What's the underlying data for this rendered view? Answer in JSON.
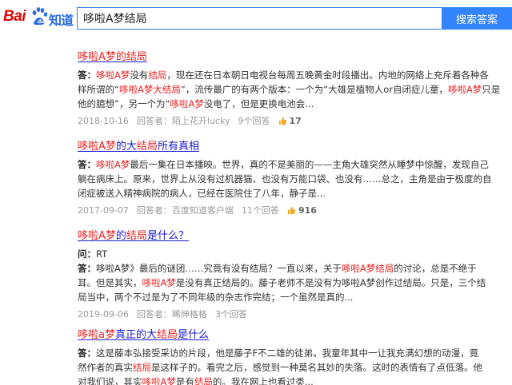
{
  "logo": {
    "bai": "Bai",
    "zhidao": "知道"
  },
  "search": {
    "query": "哆啦A梦结局",
    "button": "搜索答案"
  },
  "results": [
    {
      "title": [
        {
          "t": "哆啦A梦的",
          "h": true
        },
        {
          "t": "结局",
          "h": true
        }
      ],
      "lines": [
        [
          {
            "t": "答：",
            "lab": true
          },
          {
            "t": "哆啦A梦",
            "h": true
          },
          {
            "t": "没有"
          },
          {
            "t": "结局",
            "h": true
          },
          {
            "t": "，现在还在日本朝日电视台每周五晚黄金时段播出。内地的网络上充斥着各种各"
          }
        ],
        [
          {
            "t": "样所谓的“"
          },
          {
            "t": "哆啦A梦大结局",
            "h": true
          },
          {
            "t": "”，流传最广的有两个版本：一个为“大雄是植物人or自闭症儿童，"
          },
          {
            "t": "哆啦A梦",
            "h": true
          },
          {
            "t": "只是"
          }
        ],
        [
          {
            "t": "他的臆想”，另一个为“"
          },
          {
            "t": "哆啦A梦",
            "h": true
          },
          {
            "t": "没电了，但是更换电池会..."
          }
        ]
      ],
      "date": "2018-10-16",
      "answerer": "回答者：陌上花开lucky",
      "count": "9个回答",
      "likes": "17"
    },
    {
      "title": [
        {
          "t": "哆啦A梦",
          "h": true
        },
        {
          "t": "的大"
        },
        {
          "t": "结局",
          "h": true
        },
        {
          "t": "所有真相"
        }
      ],
      "lines": [
        [
          {
            "t": "答：",
            "lab": true
          },
          {
            "t": "哆啦A梦",
            "h": true
          },
          {
            "t": "最后一集在日本播映。世界，真的不是美丽的——主角大雄突然从睡梦中惊醒，发现自己"
          }
        ],
        [
          {
            "t": "躺在病床上。原来，世界上从没有过机器猫、也没有万能口袋、也没有……总之，主角是由于极度的自"
          }
        ],
        [
          {
            "t": "闭症被送入精神病院的病人，已经在医院住了八年，静子是..."
          }
        ]
      ],
      "date": "2017-09-07",
      "answerer": "回答者：百度知道客户端",
      "count": "11个回答",
      "likes": "916"
    },
    {
      "title": [
        {
          "t": "哆啦A梦",
          "h": true
        },
        {
          "t": "的"
        },
        {
          "t": "结局",
          "h": true
        },
        {
          "t": "是什么？"
        }
      ],
      "lines": [
        [
          {
            "t": "问：",
            "lab": true
          },
          {
            "t": "RT"
          }
        ],
        [
          {
            "t": "答：",
            "lab": true
          },
          {
            "t": "哆啦A梦》最后的谜团……究竟有没有结局？一直以来，关于"
          },
          {
            "t": "哆啦A梦结局",
            "h": true
          },
          {
            "t": "的讨论，总是不绝于"
          }
        ],
        [
          {
            "t": "耳。但是其实，"
          },
          {
            "t": "哆啦A梦",
            "h": true
          },
          {
            "t": "是没有真正结局的。藤子老师不是没有为哆啦A梦创作过结局。只是，三个结"
          }
        ],
        [
          {
            "t": "局当中，两个不过是为了不同年级的杂志作完结；一个虽然是真的..."
          }
        ]
      ],
      "date": "2019-09-06",
      "answerer": "回答者：晞绅格格",
      "count": "3个回答"
    },
    {
      "title": [
        {
          "t": "哆啦a梦",
          "h": true
        },
        {
          "t": "真正的大"
        },
        {
          "t": "结局",
          "h": true
        },
        {
          "t": "是什么"
        }
      ],
      "lines": [
        [
          {
            "t": "答：",
            "lab": true
          },
          {
            "t": "这是藤本弘接受采访的片段，他是藤子F不二雄的徒弟。我童年其中一让我充满幻想的动漫，竟"
          }
        ],
        [
          {
            "t": "然作者的真实"
          },
          {
            "t": "结局",
            "h": true
          },
          {
            "t": "是这样子的。看完之后，感觉到一种莫名其妙的失落。这时的表情有了点低落。他"
          }
        ],
        [
          {
            "t": "对我们说，其实"
          },
          {
            "t": "哆啦A梦",
            "h": true
          },
          {
            "t": "是有"
          },
          {
            "t": "结局",
            "h": true
          },
          {
            "t": "的。我在网上也看过类..."
          }
        ]
      ]
    }
  ],
  "colors": {
    "accent": "#3385ff",
    "link": "#1a1ad8",
    "highlight": "#e22222",
    "thumb": "#f5a623"
  }
}
